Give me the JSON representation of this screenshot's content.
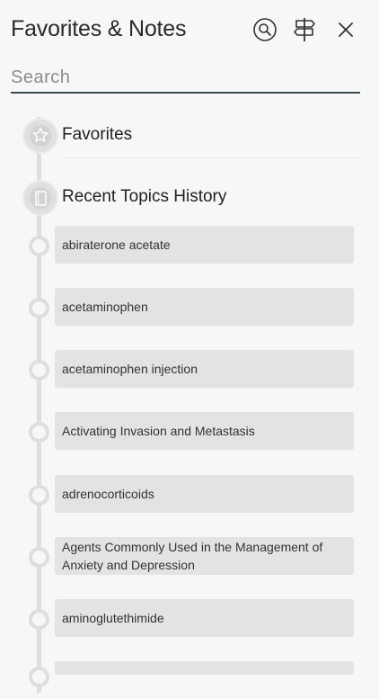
{
  "header": {
    "title": "Favorites & Notes"
  },
  "search": {
    "placeholder": "Search"
  },
  "icons": {
    "search": "search-icon",
    "signpost": "signpost-icon",
    "close": "close-icon",
    "favorites": "star-icon",
    "recent": "book-icon"
  },
  "sections": {
    "favorites_label": "Favorites",
    "recent_label": "Recent Topics History"
  },
  "recent_topics": [
    "abiraterone acetate",
    "acetaminophen",
    "acetaminophen injection",
    "Activating Invasion and Metastasis",
    "adrenocorticoids",
    "Agents Commonly Used in the Management of Anxiety and Depression",
    "aminoglutethimide"
  ],
  "colors": {
    "background": "#f7f7f7",
    "card": "#e3e3e3",
    "timeline": "#dedede",
    "search_underline": "#3b4a50"
  }
}
